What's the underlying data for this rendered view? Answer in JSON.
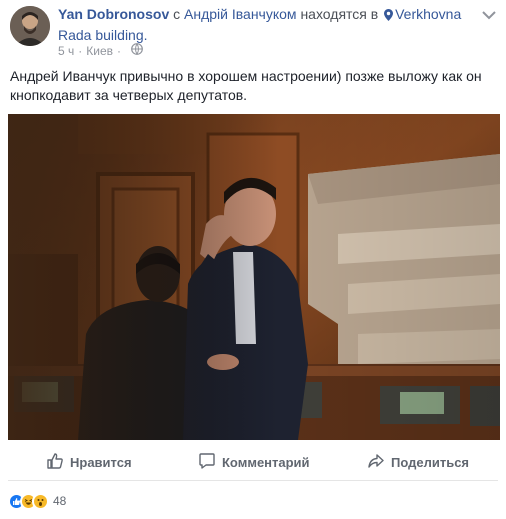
{
  "post": {
    "author": "Yan Dobronosov",
    "with_prefix": "с",
    "with_name": "Андрій Іванчуком",
    "at_prefix": "находятся в",
    "place": "Verkhovna Rada building.",
    "time": "5 ч",
    "location": "Киев",
    "text": "Андрей Иванчук привычно в хорошем настроении) позже выложу как он кнопкодавит за четверых депутатов.",
    "icons": {
      "avatar": "profile-avatar",
      "place": "map-pin-icon",
      "privacy": "globe-icon",
      "menu": "more-options-icon"
    }
  },
  "actions": {
    "like_label": "Нравится",
    "comment_label": "Комментарий",
    "share_label": "Поделиться"
  },
  "reactions": {
    "count": "48",
    "types": [
      "like",
      "haha",
      "wow"
    ]
  },
  "colors": {
    "link": "#365899",
    "like_blue": "#1877f2",
    "reaction_yellow": "#f7b928",
    "meta_gray": "#90949c",
    "action_gray": "#616770"
  }
}
